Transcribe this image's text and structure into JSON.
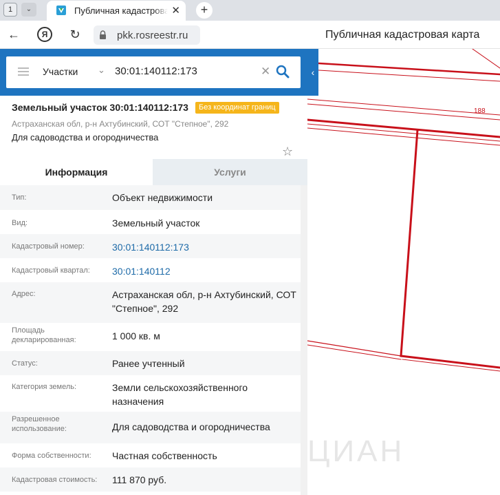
{
  "browser": {
    "tab_count": "1",
    "tab_title": "Публичная кадастровая карта",
    "url": "pkk.rosreestr.ru",
    "page_heading": "Публичная кадастровая карта"
  },
  "search": {
    "type": "Участки",
    "query": "30:01:140112:173"
  },
  "object": {
    "title": "Земельный участок 30:01:140112:173",
    "badge": "Без координат границ",
    "address": "Астраханская обл, р-н Ахтубинский, СОТ \"Степное\", 292",
    "use": "Для садоводства и огородничества"
  },
  "tabs": {
    "info": "Информация",
    "services": "Услуги"
  },
  "rows": [
    {
      "label": "Тип:",
      "value": "Объект недвижимости",
      "link": false
    },
    {
      "label": "Вид:",
      "value": "Земельный участок",
      "link": false
    },
    {
      "label": "Кадастровый номер:",
      "value": "30:01:140112:173",
      "link": true
    },
    {
      "label": "Кадастровый квартал:",
      "value": "30:01:140112",
      "link": true
    },
    {
      "label": "Адрес:",
      "value": "Астраханская обл, р-н Ахтубинский, СОТ \"Степное\", 292",
      "link": false
    },
    {
      "label": "Площадь декларированная:",
      "value": "1 000 кв. м",
      "link": false
    },
    {
      "label": "Статус:",
      "value": "Ранее учтенный",
      "link": false
    },
    {
      "label": "Категория земель:",
      "value": "Земли сельскохозяйственного назначения",
      "link": false
    },
    {
      "label": "Разрешенное использование:",
      "value": "Для садоводства и огородничества",
      "link": false
    },
    {
      "label": "Форма собственности:",
      "value": "Частная собственность",
      "link": false
    },
    {
      "label": "Кадастровая стоимость:",
      "value": "111 870 руб.",
      "link": false
    }
  ],
  "map": {
    "parcel_label": "188",
    "watermark": "ЦИАН",
    "line_color": "#c8101a"
  }
}
